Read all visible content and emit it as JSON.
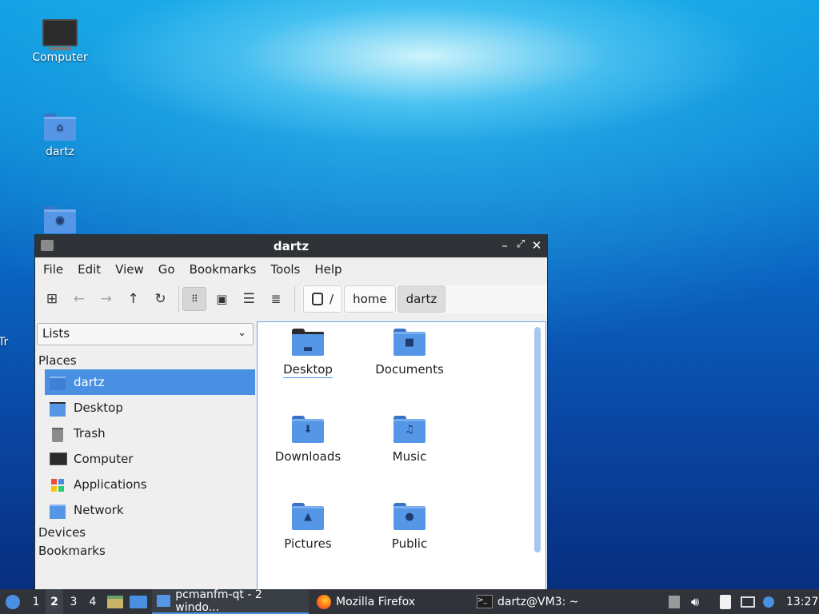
{
  "desktop": {
    "icons": [
      {
        "label": "Computer"
      },
      {
        "label": "dartz"
      },
      {
        "label": ""
      }
    ],
    "partial_label": "Tr"
  },
  "window": {
    "title": "dartz",
    "menu": [
      "File",
      "Edit",
      "View",
      "Go",
      "Bookmarks",
      "Tools",
      "Help"
    ],
    "breadcrumb": [
      "/",
      "home",
      "dartz"
    ],
    "side": {
      "selector_value": "Lists",
      "places_label": "Places",
      "places": [
        "dartz",
        "Desktop",
        "Trash",
        "Computer",
        "Applications",
        "Network"
      ],
      "devices_label": "Devices",
      "bookmarks_label": "Bookmarks"
    },
    "files": [
      "Desktop",
      "Documents",
      "Downloads",
      "Music",
      "Pictures",
      "Public"
    ]
  },
  "taskbar": {
    "workspaces": [
      "1",
      "2",
      "3",
      "4"
    ],
    "current_workspace": "2",
    "tasks": [
      "pcmanfm-qt - 2 windo...",
      "Mozilla Firefox",
      "dartz@VM3: ~"
    ],
    "clock": "13:27"
  },
  "colors": {
    "accent": "#4a90e2",
    "folder": "#5596e6",
    "titlebar": "#2f3237",
    "taskbar": "#30343a"
  }
}
